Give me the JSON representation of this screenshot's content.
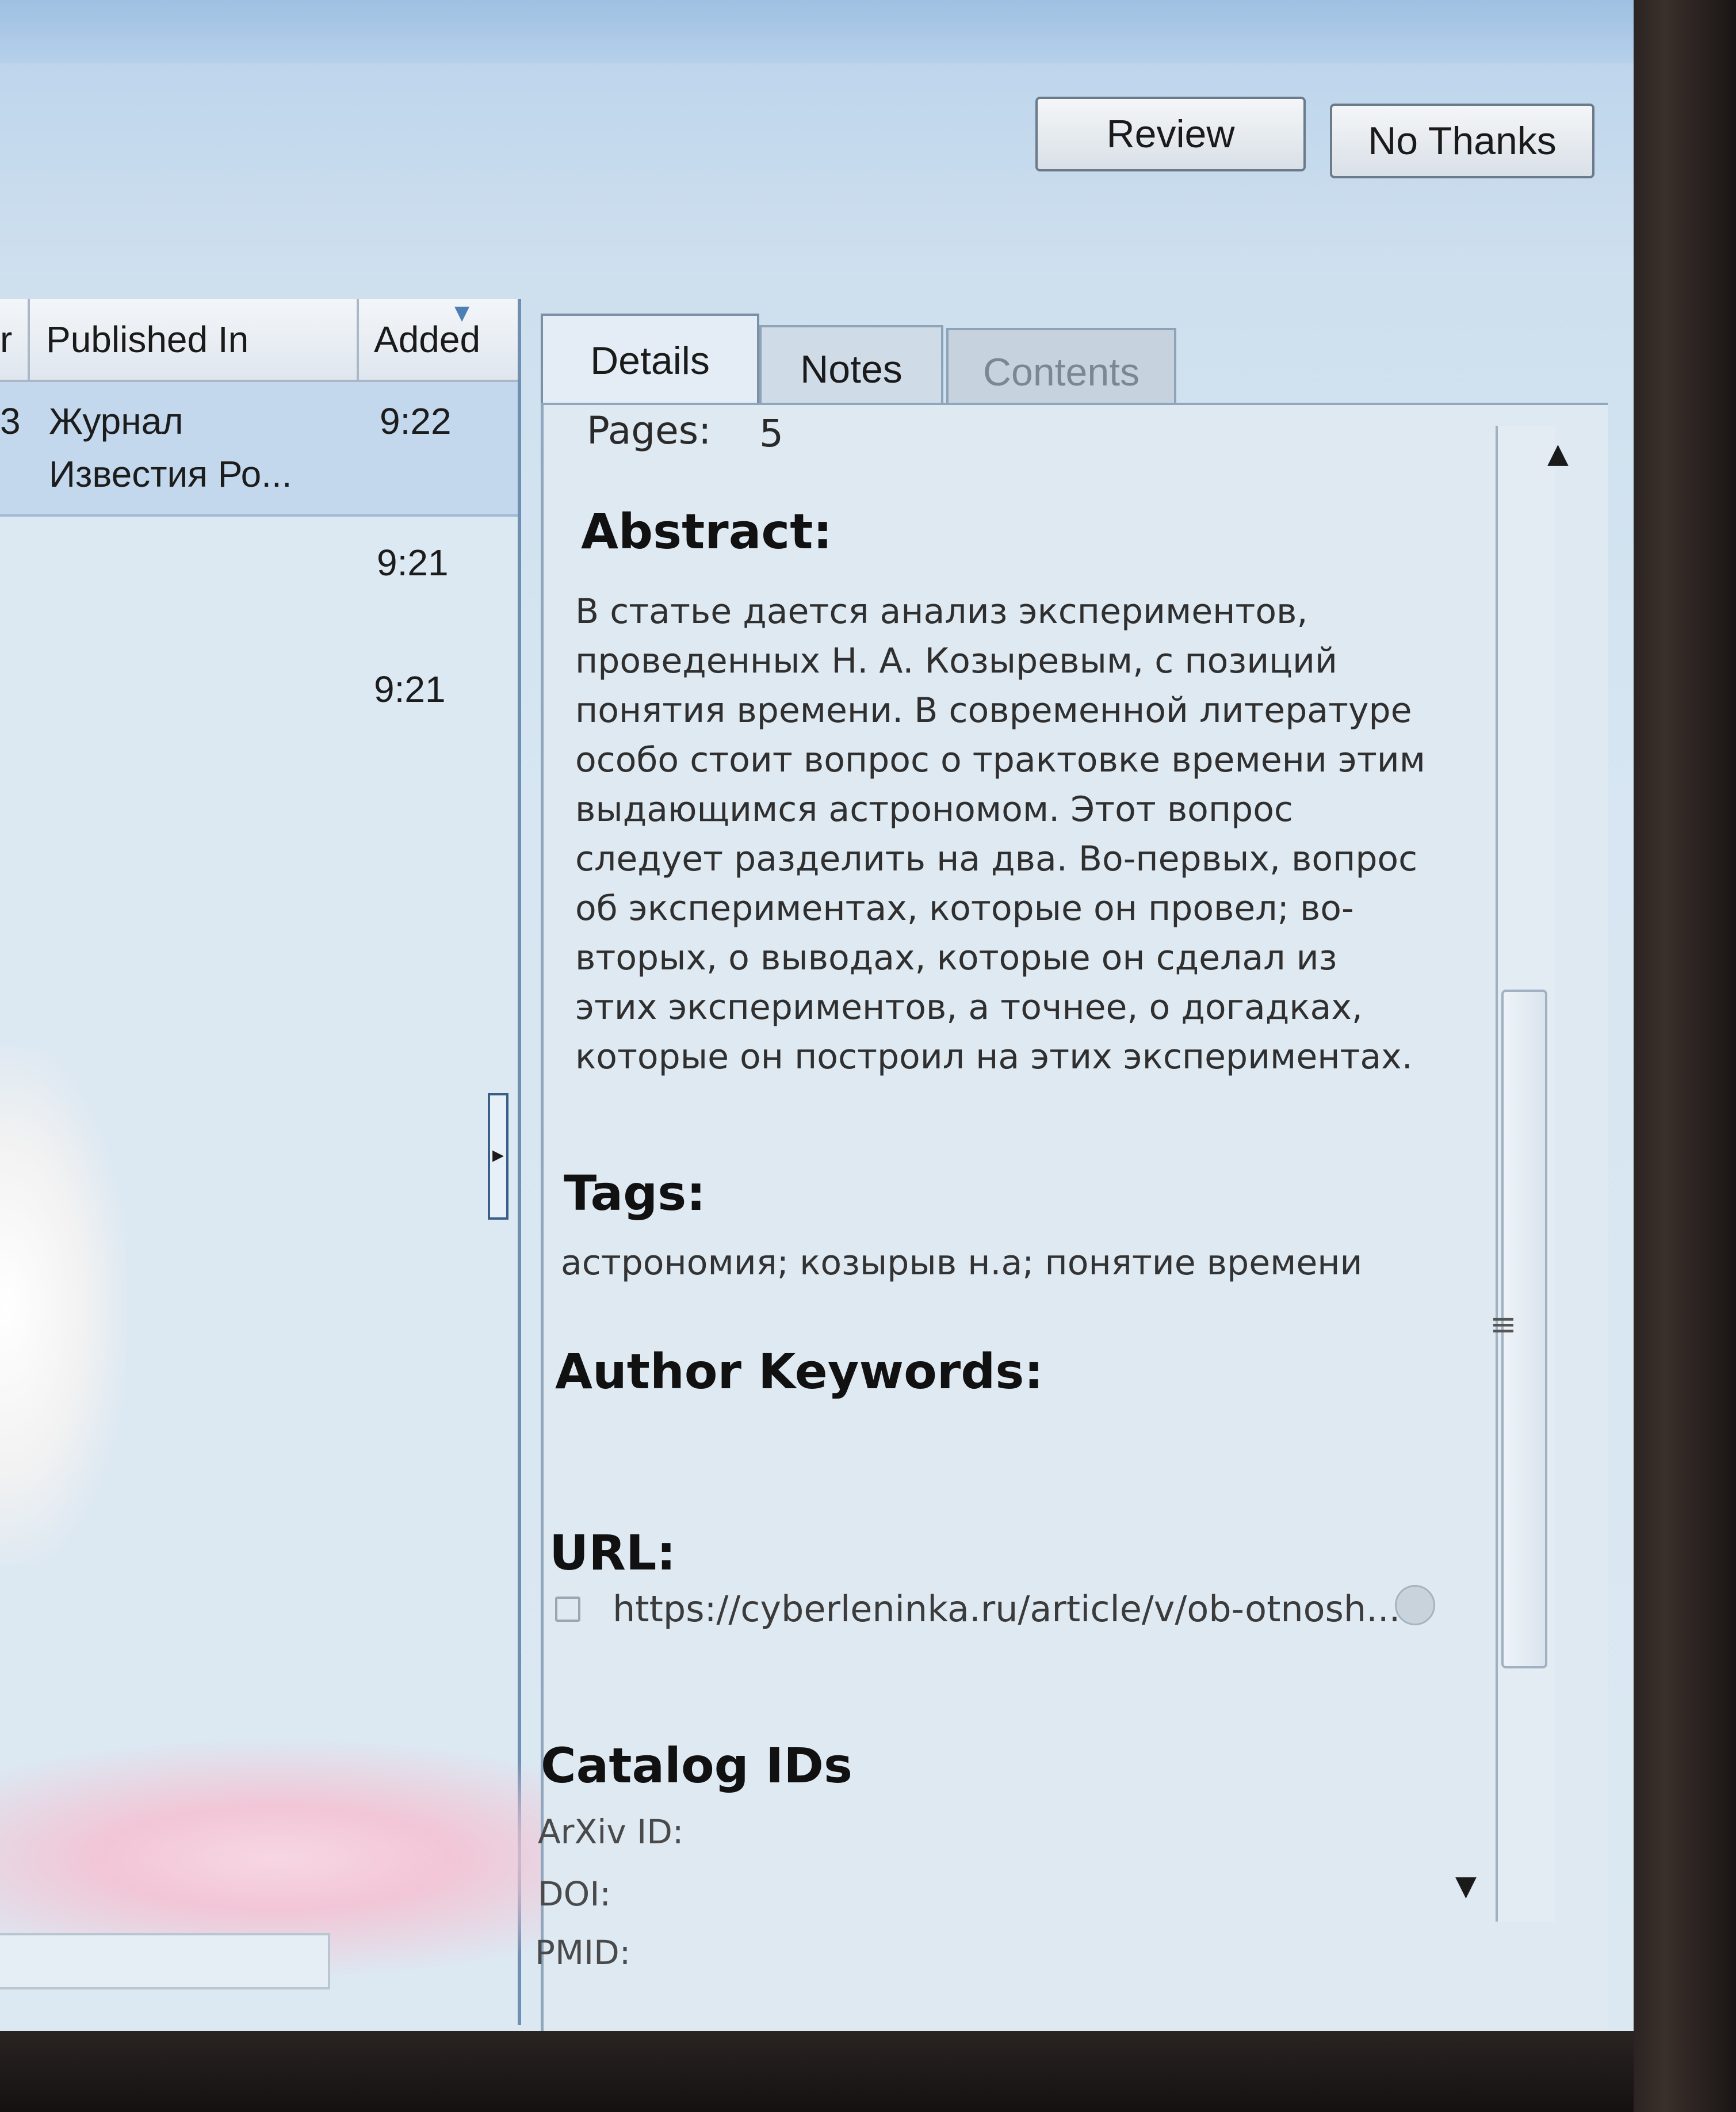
{
  "buttons": {
    "review": "Review",
    "no_thanks": "No Thanks"
  },
  "list": {
    "columns": {
      "prev_truncated": "r",
      "published_in": "Published In",
      "added": "Added"
    },
    "rows": [
      {
        "published_in_line1": "Журнал",
        "published_in_line2": "Известия Ро...",
        "added": "9:22",
        "selected": true
      },
      {
        "published_in_line1": "",
        "published_in_line2": "",
        "added": "9:21",
        "selected": false
      },
      {
        "published_in_line1": "",
        "published_in_line2": "",
        "added": "9:21",
        "selected": false
      }
    ]
  },
  "tabs": [
    {
      "label": "Details",
      "active": true
    },
    {
      "label": "Notes",
      "active": false
    },
    {
      "label": "Contents",
      "active": false,
      "disabled": true
    }
  ],
  "details": {
    "pages_label": "Pages:",
    "pages_value": "5",
    "abstract_label": "Abstract:",
    "abstract_text": "В статье дается анализ экспериментов,\nпроведенных Н. А. Козыревым, с позиций\nпонятия времени. В современной литературе\nособо стоит вопрос о трактовке времени этим\nвыдающимся астрономом. Этот вопрос\nследует разделить на два. Во-первых, вопрос\nоб экспериментах, которые он провел; во-\nвторых, о выводах, которые он сделал из\nэтих экспериментов, а точнее, о догадках,\nкоторые он построил на этих экспериментах.",
    "tags_label": "Tags:",
    "tags_text": "астрономия; козырыв н.а; понятие времени",
    "author_keywords_label": "Author Keywords:",
    "url_label": "URL:",
    "url_value": "https://cyberleninka.ru/article/v/ob-otnosh...",
    "catalog_label": "Catalog IDs",
    "arxiv_label": "ArXiv ID:",
    "doi_label": "DOI:",
    "pmid_label": "PMID:"
  },
  "icons": {
    "sort": "sort-desc-icon",
    "scroll_up": "chevron-up-icon",
    "scroll_down": "chevron-down-icon",
    "splitter": "collapse-arrow-icon",
    "url": "url-checkbox-icon",
    "url_go": "open-link-icon",
    "grip": "scroll-grip-icon"
  }
}
